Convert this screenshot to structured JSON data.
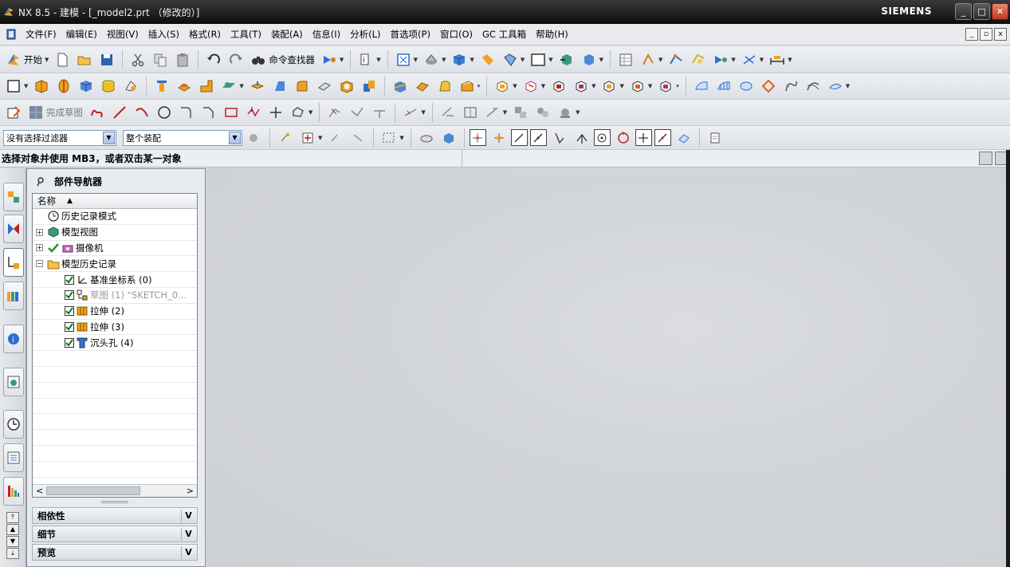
{
  "window": {
    "title": "NX 8.5 - 建模 - [_model2.prt （修改的）]",
    "brand": "SIEMENS",
    "controls": [
      "_",
      "□",
      "✕"
    ]
  },
  "menubar": {
    "items": [
      "文件(F)",
      "编辑(E)",
      "视图(V)",
      "插入(S)",
      "格式(R)",
      "工具(T)",
      "装配(A)",
      "信息(I)",
      "分析(L)",
      "首选项(P)",
      "窗口(O)",
      "GC 工具箱",
      "帮助(H)"
    ],
    "mdi_controls": [
      "_",
      "▫",
      "x"
    ]
  },
  "toolbar_standard": {
    "start_label": "开始",
    "command_finder_label": "命令查找器"
  },
  "toolbar_sketch": {
    "finish_sketch_label": "完成草图"
  },
  "selection_bar": {
    "filter_value": "没有选择过滤器",
    "scope_value": "整个装配"
  },
  "cue_line": {
    "text": "选择对象并使用 MB3，或者双击某一对象"
  },
  "part_navigator": {
    "title": "部件导航器",
    "column_header": "名称",
    "sort_indicator": "▲",
    "nodes": [
      {
        "label": "历史记录模式",
        "icon": "clock-icon"
      },
      {
        "label": "模型视图",
        "icon": "model-views-icon"
      },
      {
        "label": "摄像机",
        "icon": "camera-icon"
      },
      {
        "label": "模型历史记录",
        "icon": "folder-icon"
      },
      {
        "label": "基准坐标系 (0)",
        "icon": "datum-csys-icon"
      },
      {
        "label": "草图 (1) \"SKETCH_0...",
        "icon": "sketch-icon"
      },
      {
        "label": "拉伸 (2)",
        "icon": "extrude-icon"
      },
      {
        "label": "拉伸 (3)",
        "icon": "extrude-icon"
      },
      {
        "label": "沉头孔 (4)",
        "icon": "counterbore-hole-icon"
      }
    ],
    "scroll_left": "<",
    "scroll_right": ">",
    "sections": [
      {
        "label": "相依性",
        "chevron": "V"
      },
      {
        "label": "细节",
        "chevron": "V"
      },
      {
        "label": "预览",
        "chevron": "V"
      }
    ]
  },
  "resource_bar": {
    "tabs": [
      "assembly-navigator-icon",
      "constraint-navigator-icon",
      "part-navigator-icon",
      "reuse-library-icon",
      "hd3d-tools-icon",
      "web-browser-icon",
      "history-icon",
      "system-materials-icon",
      "roles-icon"
    ]
  },
  "colors": {
    "titlebar": "#1a1a1a",
    "graphics_bg": "#d3d6d9",
    "close_button": "#c0391f"
  }
}
